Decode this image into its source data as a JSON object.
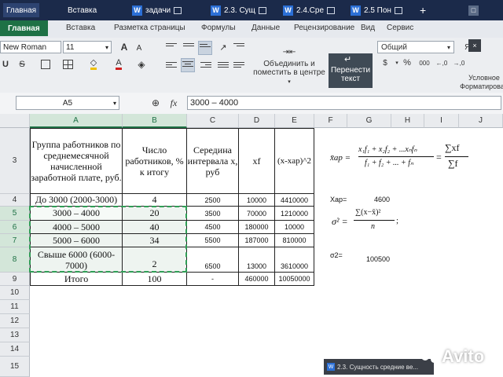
{
  "taskbar": {
    "items": [
      {
        "label": "Главная"
      },
      {
        "label": "Вставка"
      },
      {
        "label": "задачи"
      },
      {
        "label": "2.3. Сущ"
      },
      {
        "label": "2.4.Сре"
      },
      {
        "label": "2.5 Пон"
      }
    ]
  },
  "ribbon_tabs": [
    "Главная",
    "Вставка",
    "Разметка страницы",
    "Формулы",
    "Данные",
    "Рецензирование",
    "Вид",
    "Сервис"
  ],
  "ribbon": {
    "font_name": "New Roman",
    "font_size": "11",
    "merge_label_1": "Объединить и",
    "merge_label_2": "поместить в центре",
    "wrap_label_1": "Перенести",
    "wrap_label_2": "текст",
    "number_format": "Общий",
    "cond_format_1": "Условное",
    "cond_format_2": "Форматирован",
    "dollar": "$",
    "percent": "%",
    "thousands": "000",
    "dec_inc": "←,0",
    "dec_dec": "→,0",
    "sort_label": "Я",
    "decor_a_big": "A",
    "decor_a_small": "A",
    "font_color_glyph": "A"
  },
  "formula_bar": {
    "name_box": "A5",
    "fx": "fx",
    "content": "3000 – 4000"
  },
  "columns": [
    "A",
    "B",
    "C",
    "D",
    "E",
    "F",
    "G",
    "H",
    "I",
    "J"
  ],
  "rows": [
    "3",
    "4",
    "5",
    "6",
    "7",
    "8",
    "9",
    "10",
    "11",
    "12",
    "13",
    "14",
    "15"
  ],
  "table": {
    "header": [
      "Группа работников по среднемесячной начисленной заработной плате, руб.",
      "Число работников, % к итогу",
      "Середина интервала х, руб",
      "xf",
      "(x-xap)^2"
    ],
    "rows": [
      [
        "До 3000 (2000-3000)",
        "4",
        "2500",
        "10000",
        "4410000"
      ],
      [
        "3000 – 4000",
        "20",
        "3500",
        "70000",
        "1210000"
      ],
      [
        "4000 – 5000",
        "40",
        "4500",
        "180000",
        "10000"
      ],
      [
        "5000 – 6000",
        "34",
        "5500",
        "187000",
        "810000"
      ],
      [
        "Свыше 6000 (6000-7000)",
        "2",
        "6500",
        "13000",
        "3610000"
      ],
      [
        "Итого",
        "100",
        "-",
        "460000",
        "10050000"
      ]
    ]
  },
  "side": {
    "xap_label": "Хар=",
    "xap_value": "4600",
    "sigma_label": "σ2=",
    "sigma_value": "100500"
  },
  "formulas": {
    "mean_lhs": "x̄ар =",
    "mean_num": "x₁f₁ + x₂f₂ + ...xₙfₙ",
    "mean_den": "f₁ + f₂ + ... + fₙ",
    "mean_eq": "=",
    "sum_num": "∑xf",
    "sum_den": "∑f",
    "sigma_lhs": "σ² =",
    "sigma_num": "∑(x−x̄)²",
    "sigma_den": "n",
    "sigma_tail": ";"
  },
  "watermark": {
    "tab_text": "2.3. Сущность средние ве...",
    "brand": "Avito"
  },
  "colors": {
    "accent": "#1e7145",
    "taskbar": "#1b2a4a",
    "selection_border": "#2f9e55"
  }
}
